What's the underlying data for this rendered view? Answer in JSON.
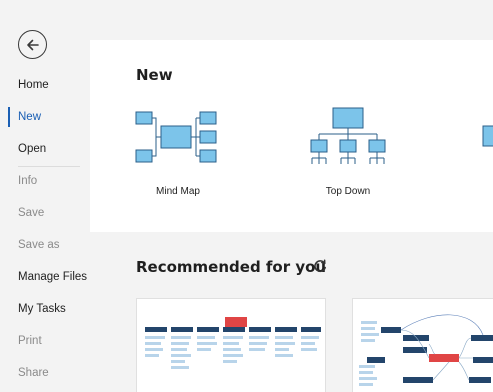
{
  "sidebar": {
    "items": [
      {
        "label": "Home",
        "state": "normal"
      },
      {
        "label": "New",
        "state": "active"
      },
      {
        "label": "Open",
        "state": "normal"
      },
      {
        "label": "Info",
        "state": "disabled"
      },
      {
        "label": "Save",
        "state": "disabled"
      },
      {
        "label": "Save as",
        "state": "disabled"
      },
      {
        "label": "Manage Files",
        "state": "normal"
      },
      {
        "label": "My Tasks",
        "state": "normal"
      },
      {
        "label": "Print",
        "state": "disabled"
      },
      {
        "label": "Share",
        "state": "disabled"
      }
    ]
  },
  "new_section": {
    "title": "New",
    "templates": [
      {
        "label": "Mind Map",
        "icon": "mind-map-icon"
      },
      {
        "label": "Top Down",
        "icon": "top-down-icon"
      },
      {
        "label": "",
        "icon": "template-icon"
      }
    ]
  },
  "recommended": {
    "title": "Recommended for you"
  },
  "colors": {
    "accent": "#1a5fb4",
    "box_fill": "#7cc4ea",
    "box_stroke": "#2b5f8a",
    "highlight": "#e04545"
  }
}
